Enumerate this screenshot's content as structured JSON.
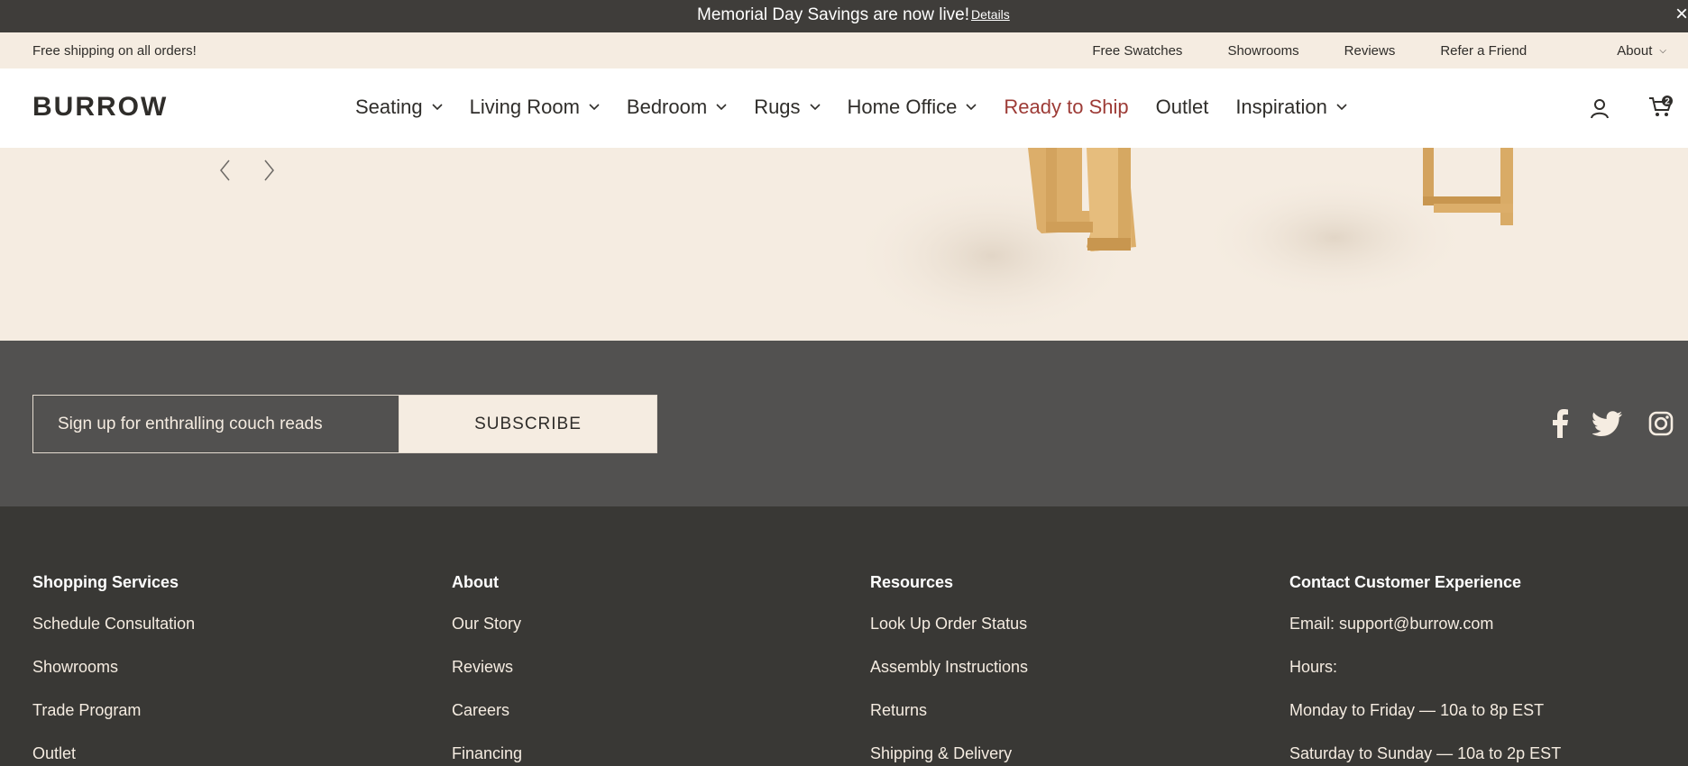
{
  "announcement": {
    "message": "Memorial Day Savings are now live!",
    "details_label": "Details",
    "close_label": "×"
  },
  "utility": {
    "shipping": "Free shipping on all orders!",
    "links": [
      "Free Swatches",
      "Showrooms",
      "Reviews",
      "Refer a Friend",
      "About"
    ]
  },
  "nav": {
    "logo": "BURROW",
    "items": [
      {
        "label": "Seating"
      },
      {
        "label": "Living Room"
      },
      {
        "label": "Bedroom"
      },
      {
        "label": "Rugs"
      },
      {
        "label": "Home Office"
      },
      {
        "label": "Ready to Ship"
      },
      {
        "label": "Outlet"
      },
      {
        "label": "Inspiration"
      }
    ],
    "cart_count": "2",
    "highlight_color": "#9d3b36"
  },
  "newsletter": {
    "placeholder": "Sign up for enthralling couch reads",
    "subscribe_label": "SUBSCRIBE"
  },
  "footer": {
    "columns": [
      {
        "heading": "Shopping Services",
        "links": [
          "Schedule Consultation",
          "Showrooms",
          "Trade Program",
          "Outlet"
        ]
      },
      {
        "heading": "About",
        "links": [
          "Our Story",
          "Reviews",
          "Careers",
          "Financing"
        ]
      },
      {
        "heading": "Resources",
        "links": [
          "Look Up Order Status",
          "Assembly Instructions",
          "Returns",
          "Shipping & Delivery"
        ]
      },
      {
        "heading": "Contact Customer Experience",
        "links": [
          "Email: support@burrow.com",
          "Hours:",
          "Monday to Friday — 10a to 8p EST",
          "Saturday to Sunday — 10a to 2p EST"
        ]
      }
    ]
  },
  "colors": {
    "dark_bar": "#3f3d3a",
    "cream": "#f5ece1",
    "newsletter_bg": "#525150",
    "footer_bg": "#393835"
  }
}
